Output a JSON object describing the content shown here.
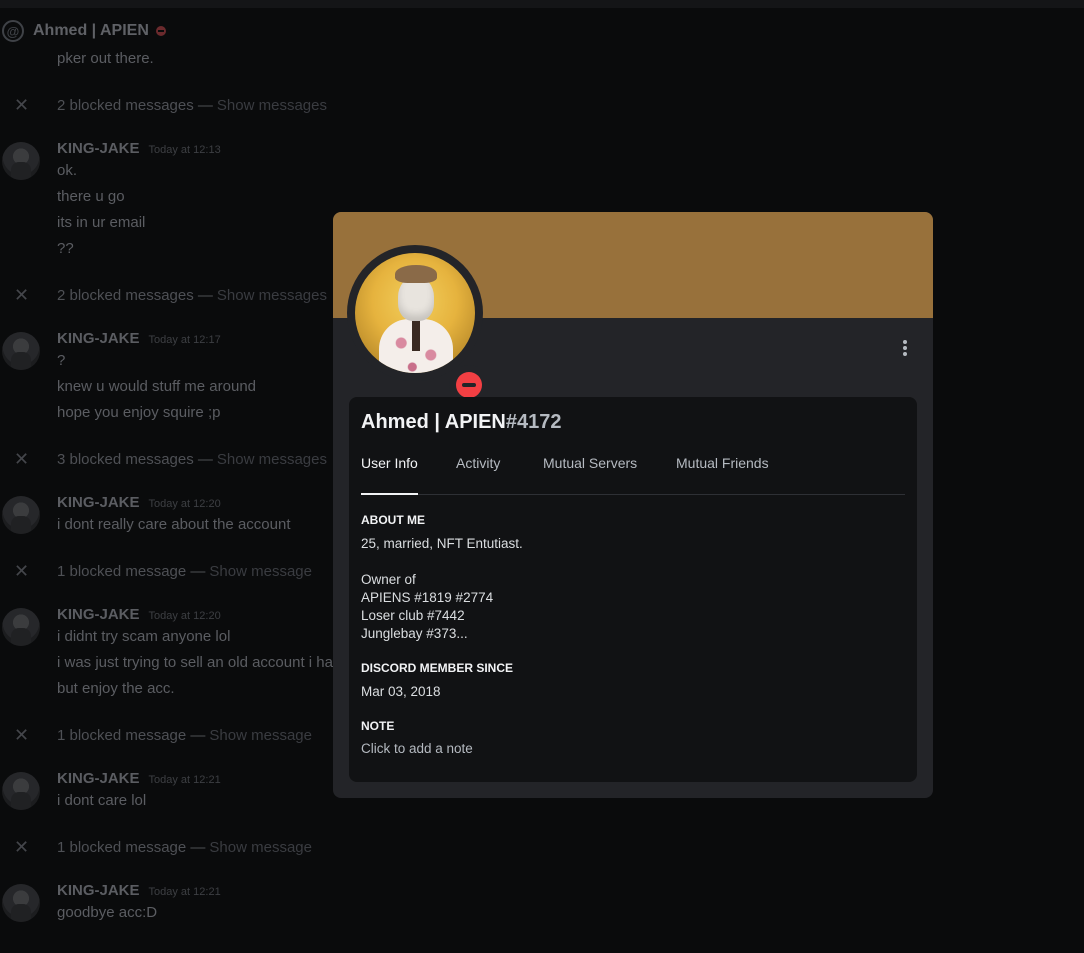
{
  "colors": {
    "banner": "#98713b",
    "status_dnd": "#f23f43",
    "modal_bg": "#232428",
    "card_bg": "#111214"
  },
  "chat": {
    "header_name": "Ahmed | APIEN",
    "header_icon": "at-icon",
    "lines_top": [
      "pker out there."
    ],
    "blocked_1": {
      "text": "2 blocked messages — ",
      "link": "Show messages"
    },
    "group_1": {
      "author": "KING-JAKE",
      "time": "Today at 12:13",
      "messages": [
        "ok.",
        "there u go",
        "its in ur email",
        "??"
      ]
    },
    "blocked_2": {
      "text": "2 blocked messages — ",
      "link": "Show messages"
    },
    "group_2": {
      "author": "KING-JAKE",
      "time": "Today at 12:17",
      "messages": [
        "?",
        "knew u would stuff me around",
        "hope you enjoy squire ;p"
      ]
    },
    "blocked_3": {
      "text": "3 blocked messages — ",
      "link": "Show messages"
    },
    "group_3": {
      "author": "KING-JAKE",
      "time": "Today at 12:20",
      "messages": [
        "i dont really care about the account"
      ]
    },
    "blocked_4": {
      "text": "1 blocked message — ",
      "link": "Show message"
    },
    "group_4": {
      "author": "KING-JAKE",
      "time": "Today at 12:20",
      "messages": [
        "i didnt try scam anyone lol",
        "i was just trying to sell an old account i ha",
        "but enjoy the acc."
      ]
    },
    "blocked_5": {
      "text": "1 blocked message — ",
      "link": "Show message"
    },
    "group_5": {
      "author": "KING-JAKE",
      "time": "Today at 12:21",
      "messages": [
        "i dont care lol"
      ]
    },
    "blocked_6": {
      "text": "1 blocked message — ",
      "link": "Show message"
    },
    "group_6": {
      "author": "KING-JAKE",
      "time": "Today at 12:21",
      "messages": [
        "goodbye acc:D"
      ]
    }
  },
  "profile": {
    "name": "Ahmed | APIEN",
    "discriminator": "#4172",
    "status": "do-not-disturb",
    "tabs": [
      "User Info",
      "Activity",
      "Mutual Servers",
      "Mutual Friends"
    ],
    "active_tab": "User Info",
    "about_title": "ABOUT ME",
    "about_lines": [
      "25, married, NFT Entutiast.",
      "",
      "Owner of",
      "APIENS #1819 #2774",
      "Loser club #7442",
      "Junglebay #373..."
    ],
    "member_since_title": "DISCORD MEMBER SINCE",
    "member_since": "Mar 03, 2018",
    "note_title": "NOTE",
    "note_placeholder": "Click to add a note"
  }
}
